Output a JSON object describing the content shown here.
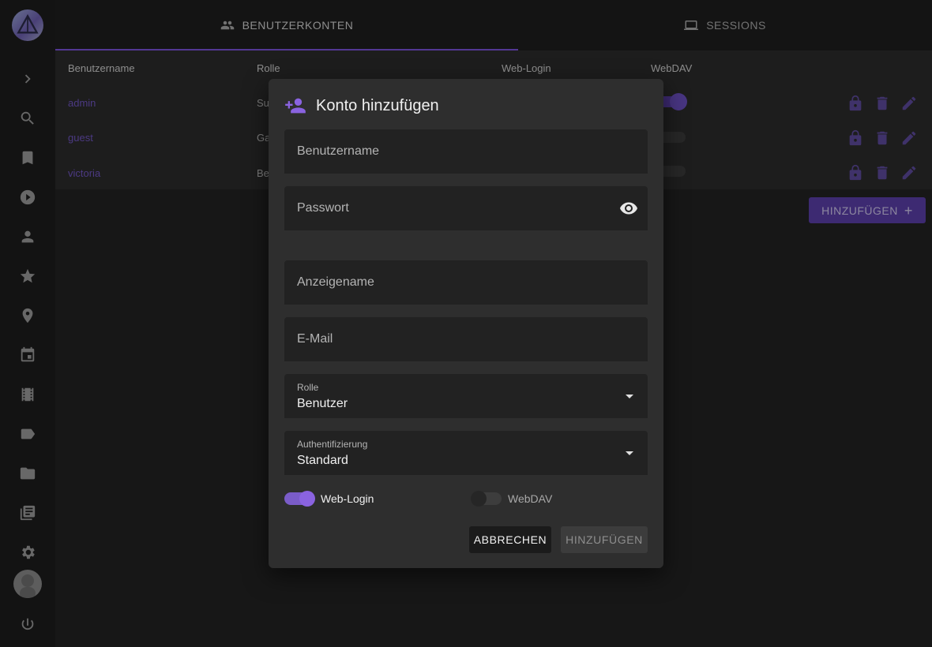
{
  "tabs": [
    {
      "label": "BENUTZERKONTEN",
      "icon": "people-icon"
    },
    {
      "label": "SESSIONS",
      "icon": "laptop-icon"
    }
  ],
  "table": {
    "headers": [
      "Benutzername",
      "Rolle",
      "Web-Login",
      "WebDAV"
    ],
    "rows": [
      {
        "username": "admin",
        "role": "Su"
      },
      {
        "username": "guest",
        "role": "Ga"
      },
      {
        "username": "victoria",
        "role": "Be"
      }
    ],
    "add_button": "HINZUFÜGEN"
  },
  "sidebar": {
    "icons": [
      "chevron-right-icon",
      "search-icon",
      "bookmark-icon",
      "play-icon",
      "person-icon",
      "star-icon",
      "place-icon",
      "calendar-icon",
      "film-icon",
      "label-icon",
      "folder-icon",
      "library-icon",
      "settings-icon",
      "power-icon"
    ]
  },
  "dialog": {
    "title": "Konto hinzufügen",
    "fields": {
      "username_placeholder": "Benutzername",
      "password_placeholder": "Passwort",
      "display_name_placeholder": "Anzeigename",
      "email_placeholder": "E-Mail",
      "role_label": "Rolle",
      "role_value": "Benutzer",
      "auth_label": "Authentifizierung",
      "auth_value": "Standard"
    },
    "switches": {
      "web_login_label": "Web-Login",
      "web_login_on": true,
      "webdav_label": "WebDAV",
      "webdav_on": false
    },
    "buttons": {
      "cancel": "ABBRECHEN",
      "add": "HINZUFÜGEN"
    }
  },
  "colors": {
    "accent": "#8a63e0",
    "background": "#222222",
    "dialog": "#2e2e2e"
  }
}
